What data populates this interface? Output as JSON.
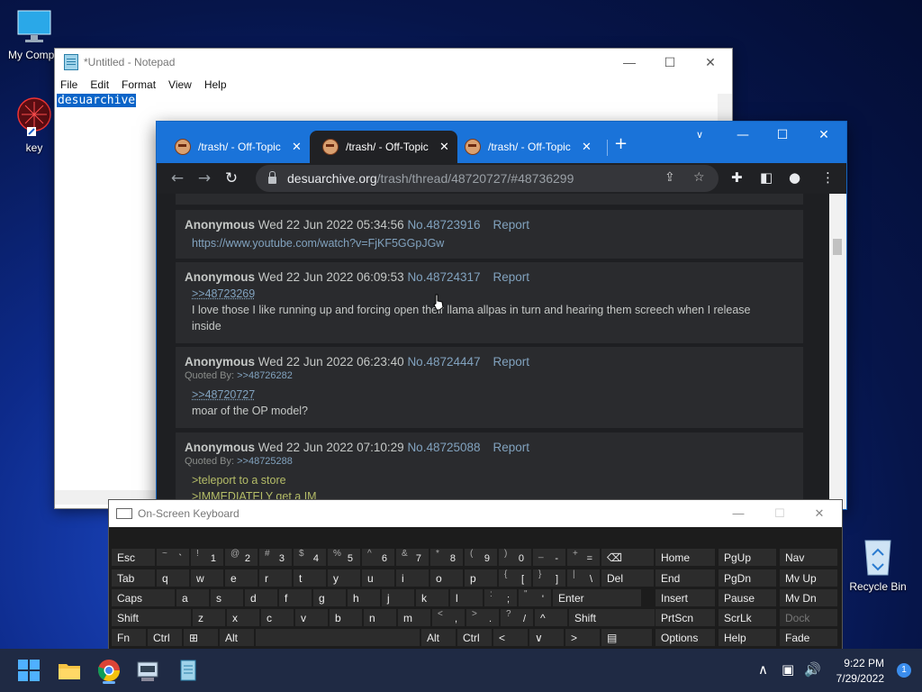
{
  "desktop": {
    "icons": [
      {
        "label": "My Compu"
      },
      {
        "label": "key"
      },
      {
        "label": "Recycle Bin"
      }
    ]
  },
  "notepad": {
    "title": "*Untitled - Notepad",
    "menu": [
      "File",
      "Edit",
      "Format",
      "View",
      "Help"
    ],
    "content": "desuarchive"
  },
  "chrome": {
    "tabs": [
      {
        "label": "/trash/ - Off-Topic"
      },
      {
        "label": "/trash/ - Off-Topic"
      },
      {
        "label": "/trash/ - Off-Topic"
      }
    ],
    "url_host": "desuarchive.org",
    "url_path": "/trash/thread/48720727/#48736299",
    "posts": [
      {
        "name": "Anonymous",
        "date": "Wed 22 Jun 2022 05:34:56",
        "no": "No.48723916",
        "report": "Report",
        "lines": [
          {
            "t": "https://www.youtube.com/watch?v=FjKF5GGpJGw",
            "k": "link"
          }
        ]
      },
      {
        "name": "Anonymous",
        "date": "Wed 22 Jun 2022 06:09:53",
        "no": "No.48724317",
        "report": "Report",
        "lines": [
          {
            "t": ">>48723269",
            "k": "ql"
          },
          {
            "t": "I love those I like running up and forcing open their llama allpas in turn and hearing them screech when I release",
            "k": ""
          },
          {
            "t": "inside",
            "k": ""
          }
        ]
      },
      {
        "name": "Anonymous",
        "date": "Wed 22 Jun 2022 06:23:40",
        "no": "No.48724447",
        "report": "Report",
        "quoted_label": "Quoted By:",
        "quoted": ">>48726282",
        "lines": [
          {
            "t": ">>48720727",
            "k": "ql"
          },
          {
            "t": "moar of the OP model?",
            "k": ""
          }
        ]
      },
      {
        "name": "Anonymous",
        "date": "Wed 22 Jun 2022 07:10:29",
        "no": "No.48725088",
        "report": "Report",
        "quoted_label": "Quoted By:",
        "quoted": ">>48725288",
        "lines": [
          {
            "t": ">teleport to a store",
            "k": "green"
          },
          {
            "t": ">IMMEDIATELY get a IM",
            "k": "green"
          }
        ]
      }
    ]
  },
  "osk": {
    "title": "On-Screen Keyboard",
    "rows": [
      [
        [
          "Esc",
          ""
        ],
        [
          "~",
          "`"
        ],
        [
          "!",
          "1"
        ],
        [
          "@",
          "2"
        ],
        [
          "#",
          "3"
        ],
        [
          "$",
          "4"
        ],
        [
          "%",
          "5"
        ],
        [
          "^",
          "6"
        ],
        [
          "&",
          "7"
        ],
        [
          "*",
          "8"
        ],
        [
          "(",
          "9"
        ],
        [
          ")",
          "0"
        ],
        [
          "_",
          "-"
        ],
        [
          "+",
          "="
        ],
        [
          "⌫",
          ""
        ]
      ],
      [
        [
          "Tab",
          ""
        ],
        [
          "q",
          ""
        ],
        [
          "w",
          ""
        ],
        [
          "e",
          ""
        ],
        [
          "r",
          ""
        ],
        [
          "t",
          ""
        ],
        [
          "y",
          ""
        ],
        [
          "u",
          ""
        ],
        [
          "i",
          ""
        ],
        [
          "o",
          ""
        ],
        [
          "p",
          ""
        ],
        [
          "{",
          "["
        ],
        [
          "}",
          "]"
        ],
        [
          "|",
          "\\"
        ],
        [
          "Del",
          ""
        ]
      ],
      [
        [
          "Caps",
          ""
        ],
        [
          "a",
          ""
        ],
        [
          "s",
          ""
        ],
        [
          "d",
          ""
        ],
        [
          "f",
          ""
        ],
        [
          "g",
          ""
        ],
        [
          "h",
          ""
        ],
        [
          "j",
          ""
        ],
        [
          "k",
          ""
        ],
        [
          "l",
          ""
        ],
        [
          ":",
          ";"
        ],
        [
          "\"",
          "'"
        ],
        [
          "Enter",
          ""
        ]
      ],
      [
        [
          "Shift",
          ""
        ],
        [
          "z",
          ""
        ],
        [
          "x",
          ""
        ],
        [
          "c",
          ""
        ],
        [
          "v",
          ""
        ],
        [
          "b",
          ""
        ],
        [
          "n",
          ""
        ],
        [
          "m",
          ""
        ],
        [
          "<",
          ","
        ],
        [
          ">",
          "."
        ],
        [
          "?",
          "/"
        ],
        [
          "^",
          ""
        ],
        [
          "Shift",
          ""
        ]
      ],
      [
        [
          "Fn",
          ""
        ],
        [
          "Ctrl",
          ""
        ],
        [
          "⊞",
          ""
        ],
        [
          "Alt",
          ""
        ],
        [
          "",
          ""
        ],
        [
          "Alt",
          ""
        ],
        [
          "Ctrl",
          ""
        ],
        [
          "<",
          ""
        ],
        [
          "∨",
          ""
        ],
        [
          ">",
          ""
        ],
        [
          "▤",
          ""
        ]
      ]
    ],
    "nav": [
      [
        "Home",
        "PgUp",
        "Nav"
      ],
      [
        "End",
        "PgDn",
        "Mv Up"
      ],
      [
        "Insert",
        "Pause",
        "Mv Dn"
      ],
      [
        "PrtScn",
        "ScrLk",
        "Dock"
      ],
      [
        "Options",
        "Help",
        "Fade"
      ]
    ]
  },
  "taskbar": {
    "time": "9:22 PM",
    "date": "7/29/2022",
    "notifications": "1"
  }
}
